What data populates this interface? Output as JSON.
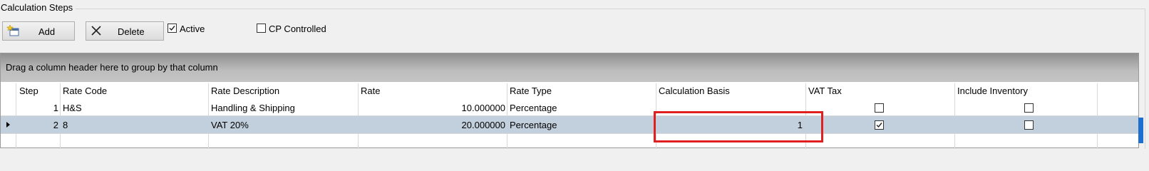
{
  "group": {
    "title": "Calculation Steps"
  },
  "toolbar": {
    "add_label": "Add",
    "delete_label": "Delete",
    "active_label": "Active",
    "active_checked": true,
    "cp_controlled_label": "CP Controlled",
    "cp_controlled_checked": false
  },
  "grid": {
    "group_hint": "Drag a column header here to group by that column",
    "columns": [
      "Step",
      "Rate Code",
      "Rate Description",
      "Rate",
      "Rate Type",
      "Calculation Basis",
      "VAT Tax",
      "Include Inventory"
    ],
    "rows": [
      {
        "step": "1",
        "rate_code": "H&S",
        "rate_description": "Handling & Shipping",
        "rate": "10.000000",
        "rate_type": "Percentage",
        "calculation_basis": "",
        "vat_tax": false,
        "include_inventory": false,
        "selected": false
      },
      {
        "step": "2",
        "rate_code": "8",
        "rate_description": "VAT 20%",
        "rate": "20.000000",
        "rate_type": "Percentage",
        "calculation_basis": "1",
        "vat_tax": true,
        "include_inventory": false,
        "selected": true
      }
    ]
  },
  "colors": {
    "selected_row": "#c2cfdc",
    "highlight_box": "#e02020",
    "group_panel": "#a8a8a8"
  }
}
